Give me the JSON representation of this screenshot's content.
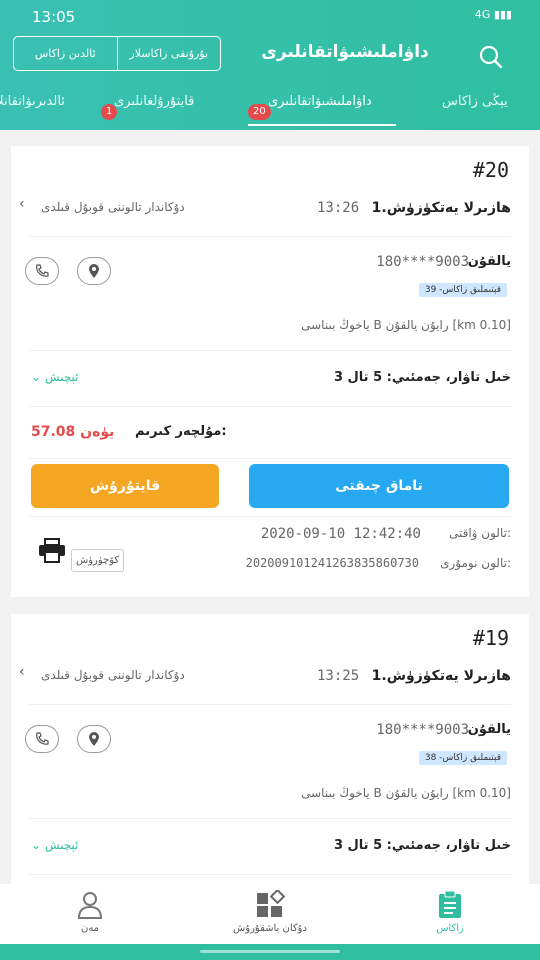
{
  "status": {
    "time": "13:05",
    "network": "4G"
  },
  "header": {
    "title": "داۋاملىشىۋاتقانلىرى",
    "segment": {
      "left": "ئالدىن زاكاس",
      "right": "بۇرۇنقى زاكاسلار"
    }
  },
  "tabs": [
    {
      "label": "يېڭى زاكاس"
    },
    {
      "label": "داۋاملىشىۋاتقانلىرى",
      "badge": "20"
    },
    {
      "label": "قايتۇرۇلغانلىرى",
      "badge": "1"
    },
    {
      "label": "ئالدىرىۋاتقانلار"
    }
  ],
  "orders": [
    {
      "number": "#20",
      "title": "1.هازىرلا يەتكۈزۈش",
      "time": "13:26",
      "status": "دۇكاندار تالوننى قوبۇل قىلدى",
      "phone_label": "يالقۇن",
      "phone": "180****9003",
      "tag": "39 -قېتىملىق زاكاس",
      "address": "ياخوڭ بىناسى B رايۇن يالقۇن [km 0.10]",
      "items_summary": "3 خىل تاۋار، جەمئىي: 5 تال",
      "expand": "ئېچىش",
      "amount_label": "مۇلچەر كىرىم:",
      "amount": "57.08 يۈەن",
      "btn_food": "تاماق چىقتى",
      "btn_return": "قايتۇرۇش",
      "time_label": "تالون ۋاقتى:",
      "order_time": "2020-09-10  12:42:40",
      "no_label": "تالون نومۇرى:",
      "order_no": "202009101241263835860730",
      "copy": "كۆچۈرۈش"
    },
    {
      "number": "#19",
      "title": "1.هازىرلا يەتكۈزۈش",
      "time": "13:25",
      "status": "دۇكاندار تالوننى قوبۇل قىلدى",
      "phone_label": "يالقۇن",
      "phone": "180****9003",
      "tag": "38 -قېتىملىق زاكاس",
      "address": "ياخوڭ بىناسى B رايۇن يالقۇن [km 0.10]",
      "items_summary": "3 خىل تاۋار، جەمئىي: 5 تال",
      "expand": "ئېچىش"
    }
  ],
  "bottom_nav": [
    {
      "label": "مەن",
      "icon": "user-icon"
    },
    {
      "label": "دۇكان باشقۇرۇش",
      "icon": "grid-icon"
    },
    {
      "label": "زاكاس",
      "icon": "clipboard-icon"
    }
  ],
  "colors": {
    "accent": "#2fbfa0",
    "blue": "#26a9f0",
    "orange": "#f5a623",
    "red": "#e64b4b"
  }
}
